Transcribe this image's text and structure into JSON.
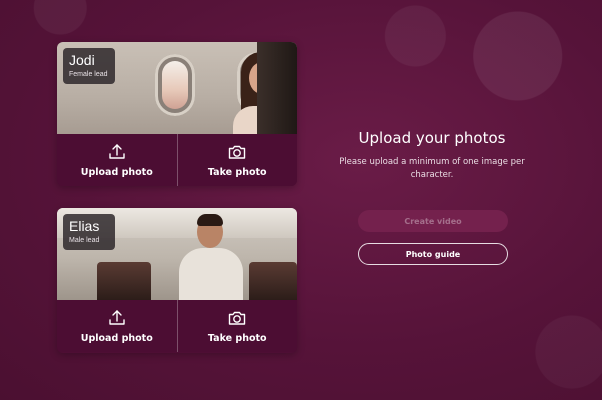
{
  "characters": [
    {
      "name": "Jodi",
      "role": "Female lead",
      "upload_label": "Upload photo",
      "take_label": "Take photo"
    },
    {
      "name": "Elias",
      "role": "Male lead",
      "upload_label": "Upload photo",
      "take_label": "Take photo"
    }
  ],
  "panel": {
    "title": "Upload your photos",
    "subtitle": "Please upload a minimum of one image per character."
  },
  "buttons": {
    "create_video": "Create video",
    "photo_guide": "Photo guide"
  },
  "colors": {
    "background": "#561339",
    "card_actions": "#4c0d33",
    "create_button_disabled": "#74214d"
  },
  "icons": {
    "upload": "upload-icon",
    "camera": "camera-icon"
  }
}
